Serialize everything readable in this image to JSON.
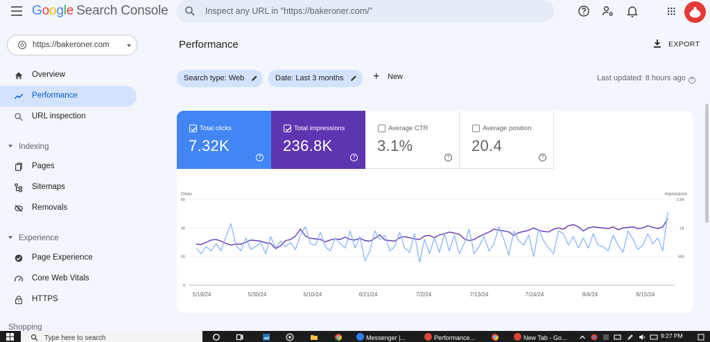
{
  "header": {
    "logo_letters": [
      {
        "ch": "G",
        "color": "#4285F4"
      },
      {
        "ch": "o",
        "color": "#EA4335"
      },
      {
        "ch": "o",
        "color": "#FBBC05"
      },
      {
        "ch": "g",
        "color": "#4285F4"
      },
      {
        "ch": "l",
        "color": "#34A853"
      },
      {
        "ch": "e",
        "color": "#EA4335"
      }
    ],
    "product": "Search Console",
    "search_placeholder": "Inspect any URL in \"https://bakeroner.com/\"",
    "icons": [
      "menu-icon",
      "search-icon",
      "help-icon",
      "account-settings-icon",
      "notifications-icon",
      "apps-grid-icon",
      "avatar"
    ]
  },
  "sidebar": {
    "property": "https://bakeroner.com",
    "items": [
      {
        "label": "Overview",
        "icon": "home-icon"
      },
      {
        "label": "Performance",
        "icon": "trending-up-icon",
        "active": true
      },
      {
        "label": "URL inspection",
        "icon": "search-icon"
      }
    ],
    "sections": [
      {
        "title": "Indexing",
        "items": [
          {
            "label": "Pages",
            "icon": "pages-icon"
          },
          {
            "label": "Sitemaps",
            "icon": "sitemap-icon"
          },
          {
            "label": "Removals",
            "icon": "removals-icon"
          }
        ]
      },
      {
        "title": "Experience",
        "items": [
          {
            "label": "Page Experience",
            "icon": "page-experience-icon"
          },
          {
            "label": "Core Web Vitals",
            "icon": "speedometer-icon"
          },
          {
            "label": "HTTPS",
            "icon": "lock-icon"
          }
        ]
      }
    ],
    "partial_section": "Shopping"
  },
  "main": {
    "title": "Performance",
    "export_label": "EXPORT",
    "filters": [
      {
        "label": "Search type: Web"
      },
      {
        "label": "Date: Last 3 months"
      }
    ],
    "new_label": "New",
    "last_updated": "Last updated: 8 hours ago"
  },
  "metrics": [
    {
      "label": "Total clicks",
      "value": "7.32K",
      "checked": true,
      "color": "#4285F4"
    },
    {
      "label": "Total impressions",
      "value": "236.8K",
      "checked": true,
      "color": "#5E35B1"
    },
    {
      "label": "Average CTR",
      "value": "3.1%",
      "checked": false
    },
    {
      "label": "Average position",
      "value": "20.4",
      "checked": false
    }
  ],
  "chart_data": {
    "type": "line",
    "x": [
      "5/19/24",
      "5/30/24",
      "6/10/24",
      "6/21/24",
      "7/2/24",
      "7/13/24",
      "7/24/24",
      "8/4/24",
      "8/15/24"
    ],
    "y_left_label": "Clicks",
    "y_left_ticks": [
      0,
      20,
      40,
      60
    ],
    "y_left_range": [
      0,
      60
    ],
    "y_right_label": "Impressions",
    "y_right_ticks": [
      "500",
      "1K",
      "1.5K"
    ],
    "y_right_range": [
      0,
      1500
    ],
    "grid": "horizontal",
    "series": [
      {
        "name": "Clicks",
        "axis": "left",
        "color": "#8AB4F8",
        "values": [
          26,
          22,
          27,
          24,
          29,
          24,
          34,
          43,
          28,
          24,
          33,
          25,
          27,
          30,
          22,
          34,
          26,
          31,
          27,
          30,
          25,
          35,
          41,
          29,
          28,
          37,
          27,
          24,
          33,
          29,
          26,
          38,
          26,
          34,
          17,
          24,
          38,
          32,
          35,
          24,
          27,
          37,
          26,
          23,
          36,
          16,
          32,
          22,
          33,
          23,
          36,
          24,
          35,
          22,
          29,
          39,
          22,
          27,
          34,
          24,
          29,
          41,
          32,
          21,
          38,
          31,
          28,
          35,
          20,
          39,
          31,
          26,
          22,
          38,
          36,
          28,
          34,
          26,
          33,
          26,
          36,
          28,
          27,
          24,
          35,
          28,
          23,
          38,
          32,
          25,
          28,
          36,
          29,
          33,
          24,
          51
        ]
      },
      {
        "name": "Impressions",
        "axis": "right",
        "color": "#5E35B1",
        "values": [
          720,
          710,
          750,
          790,
          800,
          770,
          730,
          700,
          720,
          720,
          750,
          790,
          780,
          770,
          740,
          730,
          640,
          690,
          780,
          800,
          860,
          980,
          860,
          820,
          810,
          800,
          760,
          790,
          810,
          800,
          840,
          800,
          790,
          820,
          780,
          770,
          820,
          880,
          790,
          780,
          770,
          830,
          850,
          830,
          810,
          800,
          860,
          870,
          830,
          880,
          900,
          930,
          910,
          890,
          810,
          780,
          800,
          850,
          890,
          930,
          980,
          960,
          950,
          930,
          870,
          920,
          940,
          960,
          1000,
          960,
          940,
          930,
          980,
          1000,
          980,
          1040,
          1060,
          1020,
          950,
          1000,
          1020,
          1010,
          1000,
          990,
          1020,
          970,
          1000,
          1010,
          1020,
          990,
          1000,
          1040,
          1010,
          990,
          1020,
          1160
        ]
      }
    ]
  },
  "taskbar": {
    "search_placeholder": "Type here to search",
    "apps": [
      "Messenger |...",
      "Performance...",
      "New Tab - Go..."
    ],
    "time": "9:27 PM"
  }
}
